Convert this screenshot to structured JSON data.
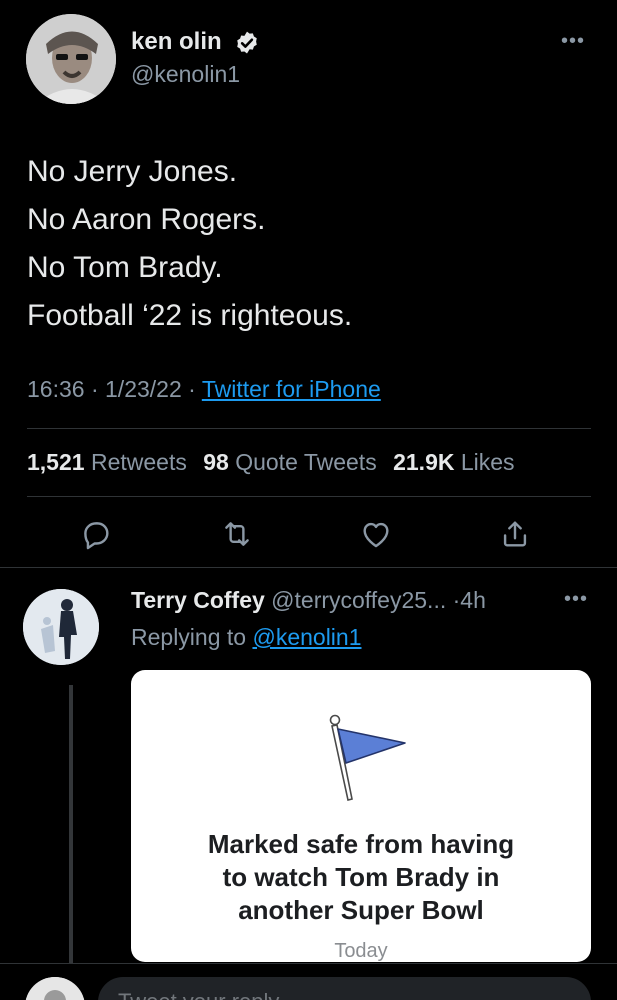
{
  "tweet": {
    "author_name": "ken olin",
    "author_handle": "@kenolin1",
    "verified": true,
    "text_lines": [
      "No Jerry Jones.",
      "No Aaron Rogers.",
      "No Tom Brady.",
      "Football ‘22 is righteous."
    ],
    "time": "16:36",
    "date": "1/23/22",
    "separator": "·",
    "source": "Twitter for iPhone",
    "more_icon": "more-horizontal-icon"
  },
  "stats": {
    "retweets_count": "1,521",
    "retweets_label": "Retweets",
    "quotes_count": "98",
    "quotes_label": "Quote Tweets",
    "likes_count": "21.9K",
    "likes_label": "Likes"
  },
  "actions": [
    {
      "name": "reply",
      "icon": "comment-icon"
    },
    {
      "name": "retweet",
      "icon": "retweet-icon"
    },
    {
      "name": "like",
      "icon": "heart-icon"
    },
    {
      "name": "share",
      "icon": "share-icon"
    }
  ],
  "reply": {
    "author_name": "Terry Coffey",
    "author_handle": "@terrycoffey25...",
    "separator": "·",
    "time": "4h",
    "replying_prefix": "Replying to",
    "replying_handle": "@kenolin1",
    "card": {
      "headline_lines": [
        "Marked safe from having",
        "to watch Tom Brady in",
        "another Super Bowl"
      ],
      "footer": "Today"
    }
  },
  "compose": {
    "placeholder": "Tweet your reply"
  },
  "colors": {
    "background": "#000000",
    "text": "#e7e9ea",
    "muted": "#8b98a5",
    "accent": "#1d9bf0",
    "flag": "#5b7fd6"
  }
}
